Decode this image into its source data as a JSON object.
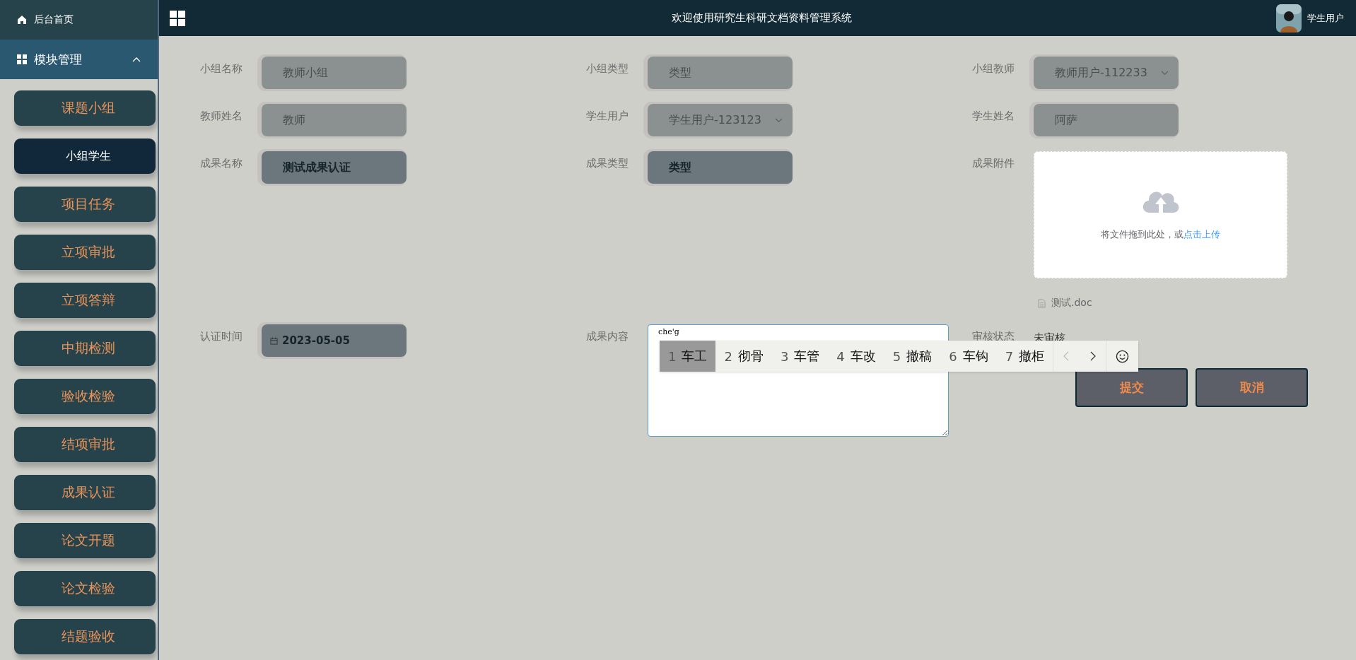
{
  "header": {
    "title": "欢迎使用研究生科研文档资料管理系统",
    "user": "学生用户"
  },
  "sidebar": {
    "home": "后台首页",
    "module": {
      "label": "模块管理",
      "expanded": true
    },
    "items": [
      {
        "label": "课题小组",
        "selected": false
      },
      {
        "label": "小组学生",
        "selected": true
      },
      {
        "label": "项目任务",
        "selected": false
      },
      {
        "label": "立项审批",
        "selected": false
      },
      {
        "label": "立项答辩",
        "selected": false
      },
      {
        "label": "中期检测",
        "selected": false
      },
      {
        "label": "验收检验",
        "selected": false
      },
      {
        "label": "结项审批",
        "selected": false
      },
      {
        "label": "成果认证",
        "selected": false
      },
      {
        "label": "论文开题",
        "selected": false
      },
      {
        "label": "论文检验",
        "selected": false
      },
      {
        "label": "结题验收",
        "selected": false
      }
    ]
  },
  "form": {
    "fields": [
      {
        "label": "小组名称",
        "kind": "text",
        "value": "教师小组",
        "disabled": true
      },
      {
        "label": "小组类型",
        "kind": "text",
        "value": "类型",
        "disabled": true
      },
      {
        "label": "小组教师",
        "kind": "select",
        "value": "教师用户-112233",
        "disabled": true
      },
      {
        "label": "教师姓名",
        "kind": "text",
        "value": "教师",
        "disabled": true
      },
      {
        "label": "学生用户",
        "kind": "select",
        "value": "学生用户-123123",
        "disabled": true
      },
      {
        "label": "学生姓名",
        "kind": "text",
        "value": "阿萨",
        "disabled": true
      },
      {
        "label": "成果名称",
        "kind": "text",
        "value": "测试成果认证",
        "disabled": false
      },
      {
        "label": "成果类型",
        "kind": "text",
        "value": "类型",
        "disabled": false
      },
      {
        "label": "成果附件",
        "kind": "upload",
        "hint": "将文件拖到此处，或",
        "link": "点击上传",
        "files": [
          "测试.doc"
        ]
      },
      {
        "label": "认证时间",
        "kind": "date",
        "value": "2023-05-05",
        "disabled": false
      },
      {
        "label": "成果内容",
        "kind": "textarea",
        "value": "che'g",
        "ime": {
          "candidates": [
            {
              "index": "1",
              "text": "车工",
              "selected": true
            },
            {
              "index": "2",
              "text": "彻骨",
              "selected": false
            },
            {
              "index": "3",
              "text": "车管",
              "selected": false
            },
            {
              "index": "4",
              "text": "车改",
              "selected": false
            },
            {
              "index": "5",
              "text": "撤稿",
              "selected": false
            },
            {
              "index": "6",
              "text": "车钩",
              "selected": false
            },
            {
              "index": "7",
              "text": "撤柜",
              "selected": false
            }
          ]
        }
      },
      {
        "label": "审核状态",
        "kind": "status",
        "value": "未审核"
      }
    ],
    "buttons": [
      "提交",
      "取消"
    ]
  }
}
